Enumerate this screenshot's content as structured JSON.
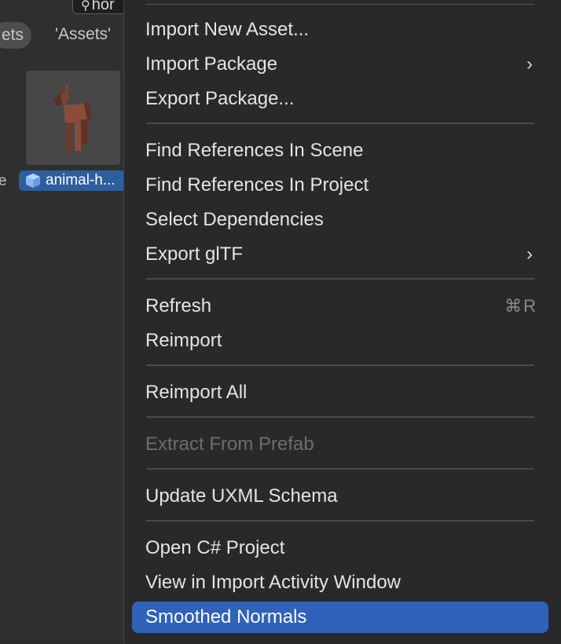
{
  "project_panel": {
    "search_text": "hor",
    "breadcrumb_pill": "ets",
    "breadcrumb_text": "'Assets'",
    "left_fragment": "e",
    "asset": {
      "label": "animal-h...",
      "icon": "prefab-cube-icon"
    }
  },
  "context_menu": {
    "items": [
      {
        "label": "Import New Asset..."
      },
      {
        "label": "Import Package",
        "submenu": true
      },
      {
        "label": "Export Package..."
      },
      {
        "label": "Find References In Scene"
      },
      {
        "label": "Find References In Project"
      },
      {
        "label": "Select Dependencies"
      },
      {
        "label": "Export glTF",
        "submenu": true
      },
      {
        "label": "Refresh",
        "shortcut": "⌘R"
      },
      {
        "label": "Reimport"
      },
      {
        "label": "Reimport All"
      },
      {
        "label": "Extract From Prefab",
        "disabled": true
      },
      {
        "label": "Update UXML Schema"
      },
      {
        "label": "Open C# Project"
      },
      {
        "label": "View in Import Activity Window"
      },
      {
        "label": "Smoothed Normals",
        "selected": true
      }
    ],
    "submenu_arrow": "›"
  },
  "colors": {
    "selection": "#2f62b8",
    "menu_bg": "#292929",
    "disabled_text": "#6d6d6d"
  }
}
